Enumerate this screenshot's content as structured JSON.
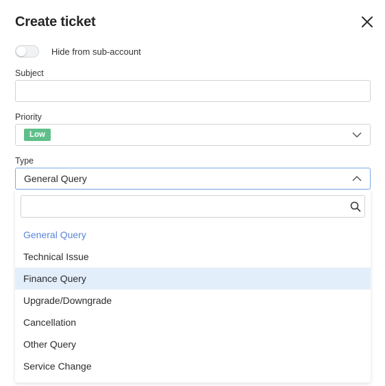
{
  "dialog": {
    "title": "Create ticket"
  },
  "toggle": {
    "label": "Hide from sub-account",
    "on": false
  },
  "subject": {
    "label": "Subject",
    "value": ""
  },
  "priority": {
    "label": "Priority",
    "value": "Low",
    "badge_color": "#5fbf8a"
  },
  "type": {
    "label": "Type",
    "value": "General Query",
    "search_value": "",
    "options": [
      {
        "label": "General Query",
        "state": "selected"
      },
      {
        "label": "Technical Issue",
        "state": ""
      },
      {
        "label": "Finance Query",
        "state": "hovered"
      },
      {
        "label": "Upgrade/Downgrade",
        "state": ""
      },
      {
        "label": "Cancellation",
        "state": ""
      },
      {
        "label": "Other Query",
        "state": ""
      },
      {
        "label": "Service Change",
        "state": ""
      }
    ]
  },
  "colors": {
    "accent": "#5b86d6",
    "hover": "#e3eefb",
    "focus_border": "#7aa8e6"
  }
}
